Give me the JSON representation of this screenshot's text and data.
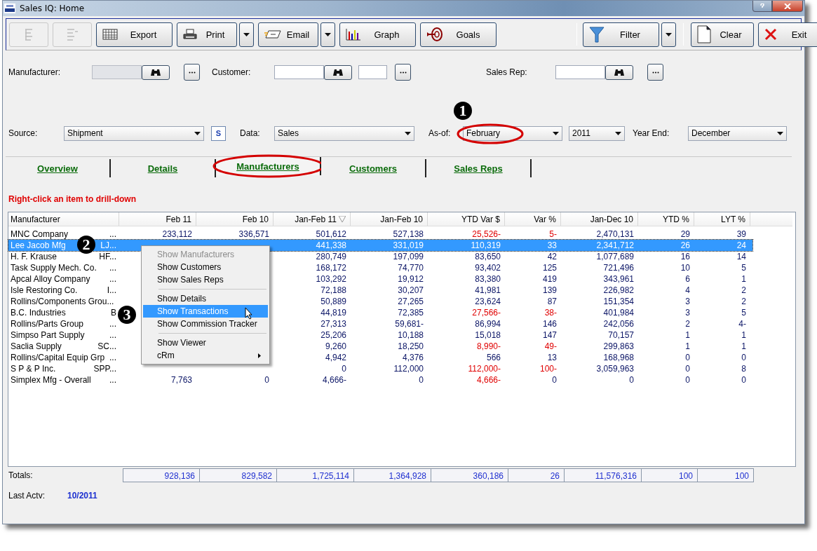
{
  "window": {
    "title": "Sales IQ: Home"
  },
  "toolbar": {
    "groups": [
      [
        {
          "kind": "icon-only",
          "disabled": true
        },
        {
          "kind": "icon-only",
          "disabled": true
        },
        {
          "kind": "button",
          "label": "Export",
          "disabled": false
        },
        {
          "kind": "split",
          "label": "Print",
          "disabled": false
        },
        {
          "kind": "split",
          "label": "Email",
          "disabled": false
        },
        {
          "kind": "button",
          "label": "Graph",
          "disabled": false
        },
        {
          "kind": "button",
          "label": "Goals",
          "disabled": false
        }
      ],
      [
        {
          "kind": "split",
          "label": "Filter",
          "disabled": false
        }
      ],
      [
        {
          "kind": "button",
          "label": "Clear",
          "disabled": false
        },
        {
          "kind": "button",
          "label": "Exit",
          "disabled": false
        }
      ]
    ]
  },
  "lookups": [
    {
      "kind": "plain",
      "label": "Manufacturer:",
      "disabled": true
    },
    {
      "kind": "with-code",
      "label": "Customer:",
      "disabled": false
    },
    {
      "kind": "plain",
      "label": "Sales Rep:",
      "disabled": false
    }
  ],
  "selectors": [
    {
      "label": "Source:",
      "value": "Shipment",
      "button": "S"
    },
    {
      "label": "Data:",
      "value": "Sales"
    },
    {
      "label": "As-of:",
      "value": "February",
      "highlighted": true
    },
    {
      "value": "2011"
    },
    {
      "label": "Year End:",
      "value": "December"
    }
  ],
  "tabs": [
    {
      "label": "Overview",
      "selected": false
    },
    {
      "label": "Details",
      "selected": false
    },
    {
      "label": "Manufacturers",
      "selected": true,
      "highlighted": true
    },
    {
      "label": "Customers",
      "selected": false
    },
    {
      "label": "Sales Reps",
      "selected": false
    }
  ],
  "hint": "Right-click an item to drill-down",
  "table": {
    "columns": [
      {
        "label": "Manufacturer",
        "sorted": false
      },
      {
        "label": "Feb 11",
        "sorted": false
      },
      {
        "label": "Feb 10",
        "sorted": false
      },
      {
        "label": "Jan-Feb 11",
        "sorted": true
      },
      {
        "label": "Jan-Feb 10",
        "sorted": false
      },
      {
        "label": "YTD Var $",
        "sorted": false
      },
      {
        "label": "Var %",
        "sorted": false
      },
      {
        "label": "Jan-Dec 10",
        "sorted": false
      },
      {
        "label": "YTD %",
        "sorted": false
      },
      {
        "label": "LYT %",
        "sorted": false
      }
    ],
    "rows": [
      {
        "selected": false,
        "cells": [
          {
            "text": "MNC Company",
            "code": "..."
          },
          {
            "text": "233,112",
            "negative": false
          },
          {
            "text": "336,571",
            "negative": false
          },
          {
            "text": "501,612",
            "negative": false
          },
          {
            "text": "527,138",
            "negative": false
          },
          {
            "text": "25,526-",
            "negative": true
          },
          {
            "text": "5-",
            "negative": true
          },
          {
            "text": "2,470,131",
            "negative": false
          },
          {
            "text": "29",
            "negative": false
          },
          {
            "text": "39",
            "negative": false
          }
        ]
      },
      {
        "selected": true,
        "cells": [
          {
            "text": "Lee Jacob Mfg",
            "code": "LJ..."
          },
          null,
          null,
          {
            "text": "441,338",
            "negative": false
          },
          {
            "text": "331,019",
            "negative": false
          },
          {
            "text": "110,319",
            "negative": false
          },
          {
            "text": "33",
            "negative": false
          },
          {
            "text": "2,341,712",
            "negative": false
          },
          {
            "text": "26",
            "negative": false
          },
          {
            "text": "24",
            "negative": false
          }
        ]
      },
      {
        "selected": false,
        "cells": [
          {
            "text": "H. F. Krause",
            "code": "HF..."
          },
          null,
          null,
          {
            "text": "280,749",
            "negative": false
          },
          {
            "text": "197,099",
            "negative": false
          },
          {
            "text": "83,650",
            "negative": false
          },
          {
            "text": "42",
            "negative": false
          },
          {
            "text": "1,077,689",
            "negative": false
          },
          {
            "text": "16",
            "negative": false
          },
          {
            "text": "14",
            "negative": false
          }
        ]
      },
      {
        "selected": false,
        "cells": [
          {
            "text": "Task Supply Mech. Co.",
            "code": "..."
          },
          null,
          null,
          {
            "text": "168,172",
            "negative": false
          },
          {
            "text": "74,770",
            "negative": false
          },
          {
            "text": "93,402",
            "negative": false
          },
          {
            "text": "125",
            "negative": false
          },
          {
            "text": "721,496",
            "negative": false
          },
          {
            "text": "10",
            "negative": false
          },
          {
            "text": "5",
            "negative": false
          }
        ]
      },
      {
        "selected": false,
        "cells": [
          {
            "text": "Apcal Alloy Company",
            "code": "..."
          },
          null,
          null,
          {
            "text": "103,292",
            "negative": false
          },
          {
            "text": "19,912",
            "negative": false
          },
          {
            "text": "83,380",
            "negative": false
          },
          {
            "text": "419",
            "negative": false
          },
          {
            "text": "343,961",
            "negative": false
          },
          {
            "text": "6",
            "negative": false
          },
          {
            "text": "1",
            "negative": false
          }
        ]
      },
      {
        "selected": false,
        "cells": [
          {
            "text": "Isle Restoring Co.",
            "code": "I..."
          },
          null,
          null,
          {
            "text": "72,188",
            "negative": false
          },
          {
            "text": "30,207",
            "negative": false
          },
          {
            "text": "41,981",
            "negative": false
          },
          {
            "text": "139",
            "negative": false
          },
          {
            "text": "226,982",
            "negative": false
          },
          {
            "text": "4",
            "negative": false
          },
          {
            "text": "2",
            "negative": false
          }
        ]
      },
      {
        "selected": false,
        "cells": [
          {
            "text": "Rollins/Components Grou..."
          },
          null,
          null,
          {
            "text": "50,889",
            "negative": false
          },
          {
            "text": "27,265",
            "negative": false
          },
          {
            "text": "23,624",
            "negative": false
          },
          {
            "text": "87",
            "negative": false
          },
          {
            "text": "151,354",
            "negative": false
          },
          {
            "text": "3",
            "negative": false
          },
          {
            "text": "2",
            "negative": false
          }
        ]
      },
      {
        "selected": false,
        "cells": [
          {
            "text": "B.C. Industries",
            "code": "B"
          },
          null,
          null,
          {
            "text": "44,819",
            "negative": false
          },
          {
            "text": "72,385",
            "negative": false
          },
          {
            "text": "27,566-",
            "negative": true
          },
          {
            "text": "38-",
            "negative": true
          },
          {
            "text": "401,984",
            "negative": false
          },
          {
            "text": "3",
            "negative": false
          },
          {
            "text": "5",
            "negative": false
          }
        ]
      },
      {
        "selected": false,
        "cells": [
          {
            "text": "Rollins/Parts Group",
            "code": "..."
          },
          null,
          null,
          {
            "text": "27,313",
            "negative": false
          },
          {
            "text": "59,681-",
            "negative": false
          },
          {
            "text": "86,994",
            "negative": false
          },
          {
            "text": "146",
            "negative": false
          },
          {
            "text": "242,056",
            "negative": false
          },
          {
            "text": "2",
            "negative": false
          },
          {
            "text": "4-",
            "negative": false
          }
        ]
      },
      {
        "selected": false,
        "cells": [
          {
            "text": "Simpso Part Supply",
            "code": "..."
          },
          null,
          null,
          {
            "text": "25,206",
            "negative": false
          },
          {
            "text": "10,188",
            "negative": false
          },
          {
            "text": "15,018",
            "negative": false
          },
          {
            "text": "147",
            "negative": false
          },
          {
            "text": "70,157",
            "negative": false
          },
          {
            "text": "1",
            "negative": false
          },
          {
            "text": "1",
            "negative": false
          }
        ]
      },
      {
        "selected": false,
        "cells": [
          {
            "text": "Saclia Supply",
            "code": "SC..."
          },
          null,
          null,
          {
            "text": "9,260",
            "negative": false
          },
          {
            "text": "18,250",
            "negative": false
          },
          {
            "text": "8,990-",
            "negative": true
          },
          {
            "text": "49-",
            "negative": true
          },
          {
            "text": "299,863",
            "negative": false
          },
          {
            "text": "1",
            "negative": false
          },
          {
            "text": "1",
            "negative": false
          }
        ]
      },
      {
        "selected": false,
        "cells": [
          {
            "text": "Rollins/Capital Equip Grp",
            "code": "..."
          },
          null,
          null,
          {
            "text": "4,942",
            "negative": false
          },
          {
            "text": "4,376",
            "negative": false
          },
          {
            "text": "566",
            "negative": false
          },
          {
            "text": "13",
            "negative": false
          },
          {
            "text": "168,968",
            "negative": false
          },
          {
            "text": "0",
            "negative": false
          },
          {
            "text": "0",
            "negative": false
          }
        ]
      },
      {
        "selected": false,
        "cells": [
          {
            "text": "S P & P Inc.",
            "code": "SPP..."
          },
          null,
          null,
          {
            "text": "0",
            "negative": false
          },
          {
            "text": "112,000",
            "negative": false
          },
          {
            "text": "112,000-",
            "negative": true
          },
          {
            "text": "100-",
            "negative": true
          },
          {
            "text": "3,059,963",
            "negative": false
          },
          {
            "text": "0",
            "negative": false
          },
          {
            "text": "8",
            "negative": false
          }
        ]
      },
      {
        "selected": false,
        "cells": [
          {
            "text": "Simplex Mfg - Overall",
            "code": "..."
          },
          {
            "text": "7,763",
            "negative": false
          },
          {
            "text": "0",
            "negative": false
          },
          {
            "text": "4,666-",
            "negative": false
          },
          {
            "text": "0",
            "negative": false
          },
          {
            "text": "4,666-",
            "negative": true
          },
          {
            "text": "0",
            "negative": false
          },
          {
            "text": "0",
            "negative": false
          },
          {
            "text": "0",
            "negative": false
          },
          {
            "text": "0",
            "negative": false
          }
        ]
      }
    ]
  },
  "totals": {
    "label": "Totals:",
    "values": [
      "928,136",
      "829,582",
      "1,725,114",
      "1,364,928",
      "360,186",
      "26",
      "11,576,316",
      "100",
      "100"
    ]
  },
  "last_activity": {
    "label": "Last Actv:",
    "value": "10/2011"
  },
  "context_menu": {
    "items": [
      {
        "kind": "item",
        "label": "Show Manufacturers",
        "disabled": true,
        "selected": false
      },
      {
        "kind": "item",
        "label": "Show Customers",
        "disabled": false,
        "selected": false
      },
      {
        "kind": "item",
        "label": "Show Sales Reps",
        "disabled": false,
        "selected": false
      },
      {
        "kind": "separator"
      },
      {
        "kind": "item",
        "label": "Show Details",
        "disabled": false,
        "selected": false
      },
      {
        "kind": "item",
        "label": "Show Transactions",
        "disabled": false,
        "selected": true
      },
      {
        "kind": "item",
        "label": "Show Commission Tracker",
        "disabled": false,
        "selected": false
      },
      {
        "kind": "separator"
      },
      {
        "kind": "item",
        "label": "Show Viewer",
        "disabled": false,
        "selected": false
      },
      {
        "kind": "submenu",
        "label": "cRm",
        "disabled": false,
        "selected": false
      }
    ]
  },
  "callouts": [
    "1",
    "2",
    "3"
  ]
}
